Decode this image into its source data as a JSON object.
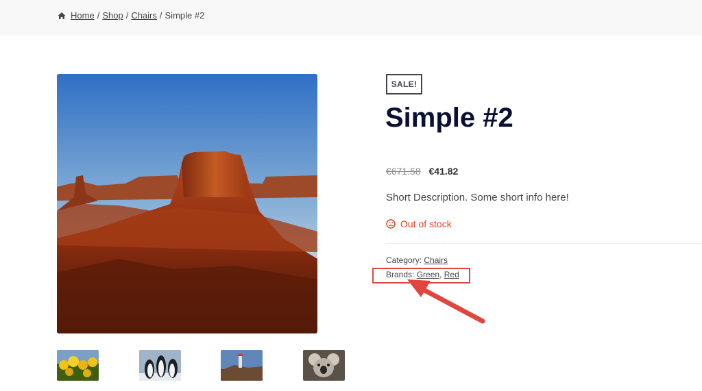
{
  "breadcrumb": {
    "icon": "home-icon",
    "items": [
      "Home",
      "Shop",
      "Chairs"
    ],
    "separator": "/",
    "current": "Simple #2"
  },
  "product": {
    "sale_badge": "SALE!",
    "title": "Simple #2",
    "price_old": "€671.58",
    "price_new": "€41.82",
    "short_description": "Short Description. Some short info here!",
    "stock_icon": "sad-face-icon",
    "stock_status": "Out of stock",
    "stock_color": "#e2401c",
    "category_label": "Category:",
    "category_value": "Chairs",
    "brands_label": "Brands:",
    "brand_1": "Green",
    "brand_separator": ",",
    "brand_2": "Red"
  },
  "gallery": {
    "main_image": "desert-butte-image",
    "thumbnails": [
      "tulips-image",
      "penguins-image",
      "lighthouse-image",
      "koala-image"
    ]
  },
  "annotation": {
    "color": "#e1463e"
  }
}
